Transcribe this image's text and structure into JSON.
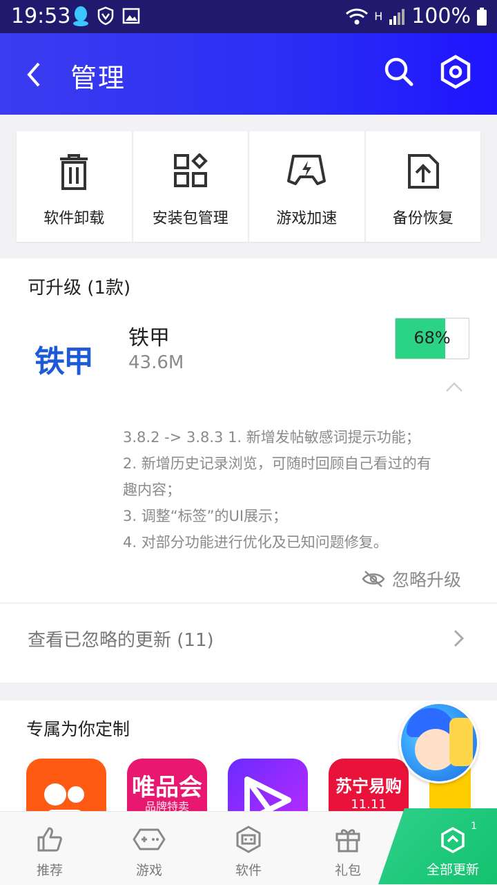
{
  "status_bar": {
    "time": "19:53",
    "battery": "100%",
    "network": "H"
  },
  "header": {
    "title": "管理"
  },
  "tools": [
    {
      "label": "软件卸载",
      "icon": "trash-icon"
    },
    {
      "label": "安装包管理",
      "icon": "grid-icon"
    },
    {
      "label": "游戏加速",
      "icon": "gamepad-boost-icon"
    },
    {
      "label": "备份恢复",
      "icon": "upload-backup-icon"
    }
  ],
  "upgrade_section": {
    "title": "可升级 (1款)",
    "app": {
      "name": "铁甲",
      "logo_text": "铁甲",
      "size": "43.6M",
      "progress": 0.68,
      "progress_label": "68%"
    },
    "notes": [
      "3.8.2 -> 3.8.3  1. 新增发帖敏感词提示功能；",
      "2. 新增历史记录浏览，可随时回顾自己看过的有",
      "趣内容；",
      "3. 调整“标签”的UI展示；",
      "4. 对部分功能进行优化及已知问题修复。"
    ],
    "ignore_label": "忽略升级",
    "ignored_label": "查看已忽略的更新 (11)"
  },
  "custom_section": {
    "title": "专属为你定制",
    "apps": [
      {
        "name": "kuaishou",
        "text": ""
      },
      {
        "name": "vipshop",
        "text": "唯品会",
        "sub": "品牌特卖"
      },
      {
        "name": "video",
        "text": ""
      },
      {
        "name": "suning",
        "text": "苏宁易购",
        "sub": "11.11"
      }
    ]
  },
  "bottom_nav": {
    "items": [
      {
        "label": "推荐",
        "icon": "thumbs-up-icon"
      },
      {
        "label": "游戏",
        "icon": "gamepad-icon"
      },
      {
        "label": "软件",
        "icon": "robot-icon"
      },
      {
        "label": "礼包",
        "icon": "gift-icon"
      }
    ],
    "update_all": {
      "label": "全部更新",
      "badge": "1"
    }
  },
  "colors": {
    "header": "#2a2ef4",
    "progress": "#2ad484",
    "update_all": "#13c26f"
  }
}
